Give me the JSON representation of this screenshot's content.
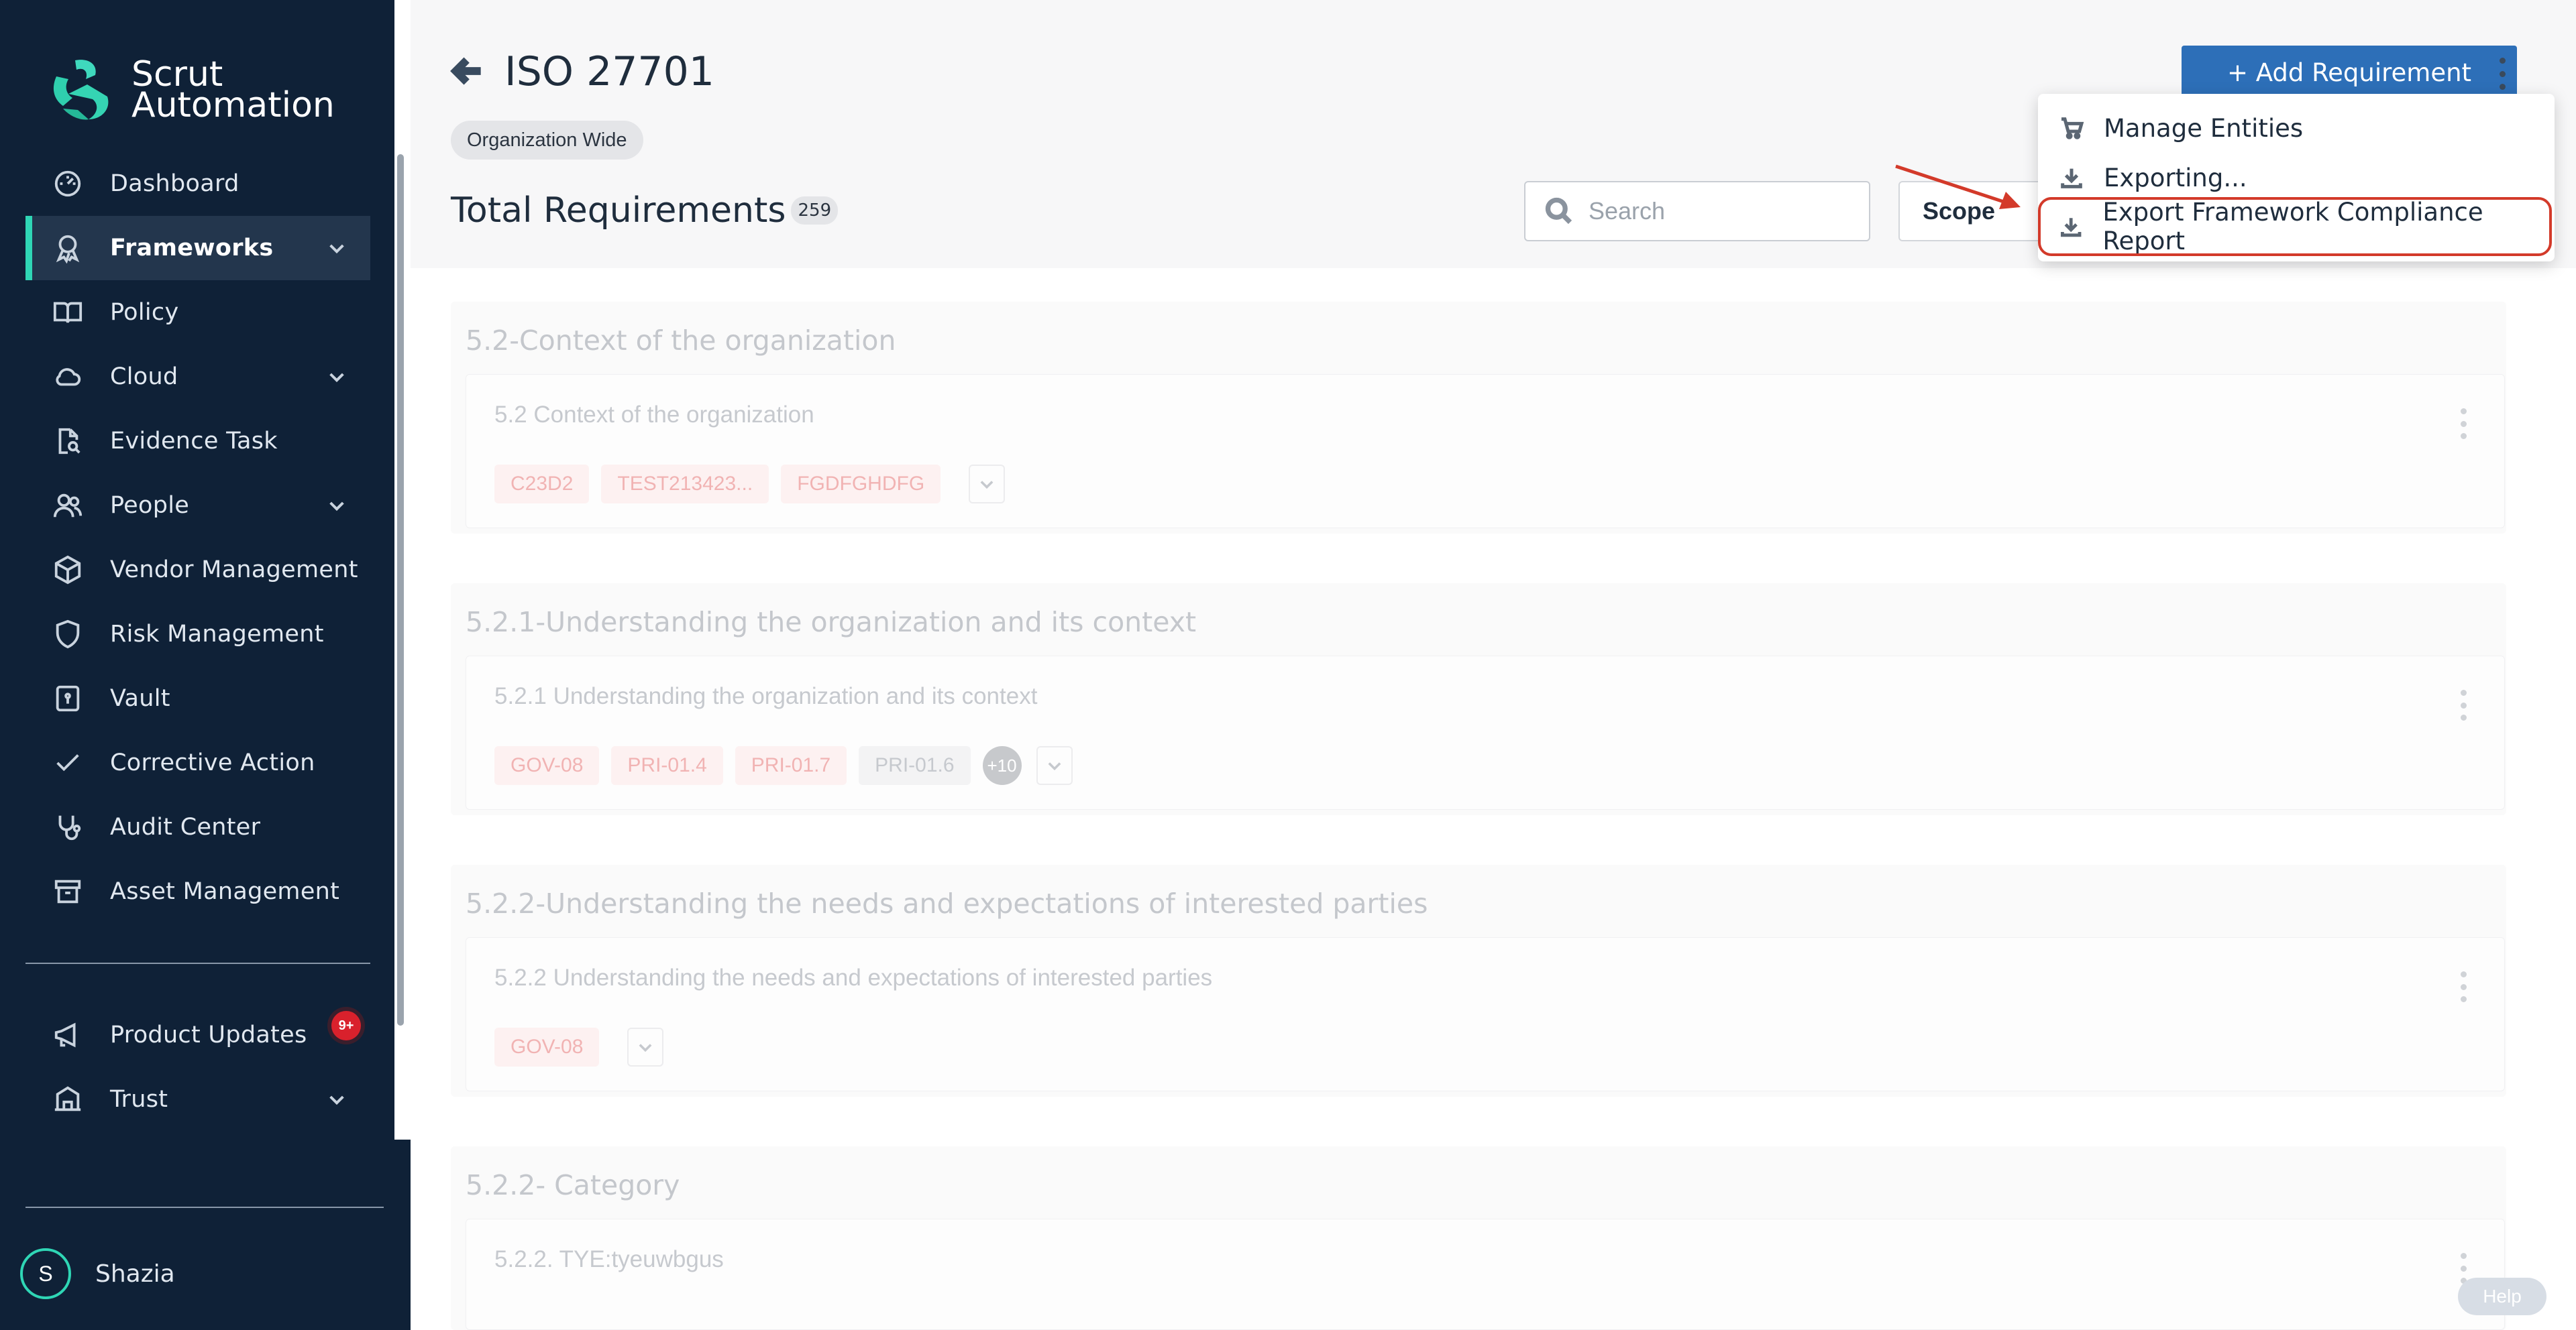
{
  "sidebar": {
    "logo_line1": "Scrut",
    "logo_line2": "Automation",
    "items": [
      {
        "label": "Dashboard"
      },
      {
        "label": "Frameworks"
      },
      {
        "label": "Policy"
      },
      {
        "label": "Cloud"
      },
      {
        "label": "Evidence Task"
      },
      {
        "label": "People"
      },
      {
        "label": "Vendor Management"
      },
      {
        "label": "Risk Management"
      },
      {
        "label": "Vault"
      },
      {
        "label": "Corrective Action"
      },
      {
        "label": "Audit Center"
      },
      {
        "label": "Asset Management"
      }
    ],
    "bottom_items": [
      {
        "label": "Product Updates",
        "badge": "9+"
      },
      {
        "label": "Trust"
      }
    ],
    "user": {
      "initial": "S",
      "name": "Shazia"
    },
    "accent": "#2fd6b5",
    "background": "#0f2137"
  },
  "header": {
    "title": "ISO 27701",
    "scope_pill": "Organization Wide",
    "total_label": "Total Requirements",
    "total_count": "259",
    "search_placeholder": "Search",
    "scope_button": "Scope",
    "add_button": "+ Add Requirement"
  },
  "menu": {
    "items": [
      {
        "label": "Manage Entities",
        "icon": "manage-entities-icon"
      },
      {
        "label": "Exporting...",
        "icon": "download-icon"
      },
      {
        "label": "Export Framework Compliance Report",
        "icon": "download-icon"
      }
    ],
    "highlight_color": "#d33a2a"
  },
  "requirements": [
    {
      "title": "5.2-Context of the organization",
      "card_title": "5.2 Context of the organization",
      "tags": [
        "C23D2",
        "TEST213423...",
        "FGDFGHDFG"
      ]
    },
    {
      "title": "5.2.1-Understanding the organization and its context",
      "card_title": "5.2.1 Understanding the organization and its context",
      "tags": [
        "GOV-08",
        "PRI-01.4",
        "PRI-01.7",
        "PRI-01.6"
      ],
      "more": "+10"
    },
    {
      "title": "5.2.2-Understanding the needs and expectations of interested parties",
      "card_title": "5.2.2 Understanding the needs and expectations of interested parties",
      "tags": [
        "GOV-08"
      ]
    },
    {
      "title": "5.2.2- Category",
      "card_title": "5.2.2. TYE:tyeuwbgus"
    }
  ],
  "help": "Help",
  "brand_color": "#2d6fb8"
}
